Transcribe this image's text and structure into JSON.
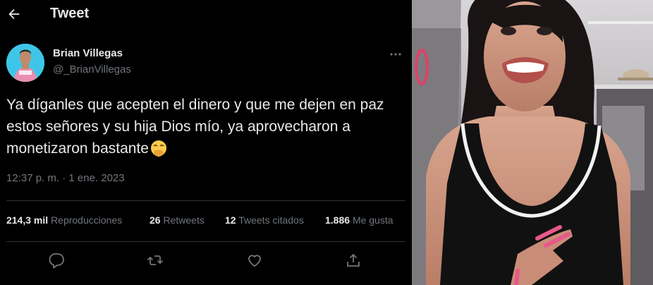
{
  "header": {
    "title": "Tweet",
    "back_icon": "arrow-left-icon"
  },
  "author": {
    "name": "Brian Villegas",
    "handle": "@_BrianVillegas"
  },
  "tweet": {
    "text": "Ya díganles que acepten el dinero y que me dejen en paz estos señores y su hija Dios mío, ya aprovecharon a monetizaron bastante",
    "emoji": "face-with-hand-over-mouth",
    "timestamp": "12:37 p. m. · 1 ene. 2023"
  },
  "stats": {
    "views_count": "214,3 mil",
    "views_label": "Reproducciones",
    "retweets_count": "26",
    "retweets_label": "Retweets",
    "quotes_count": "12",
    "quotes_label": "Tweets citados",
    "likes_count": "1.886",
    "likes_label": "Me gusta"
  },
  "actions": [
    "reply-icon",
    "retweet-icon",
    "like-icon",
    "share-icon"
  ],
  "colors": {
    "background": "#000000",
    "text": "#e7e9ea",
    "secondary": "#71767b",
    "divider": "#2f3336"
  }
}
